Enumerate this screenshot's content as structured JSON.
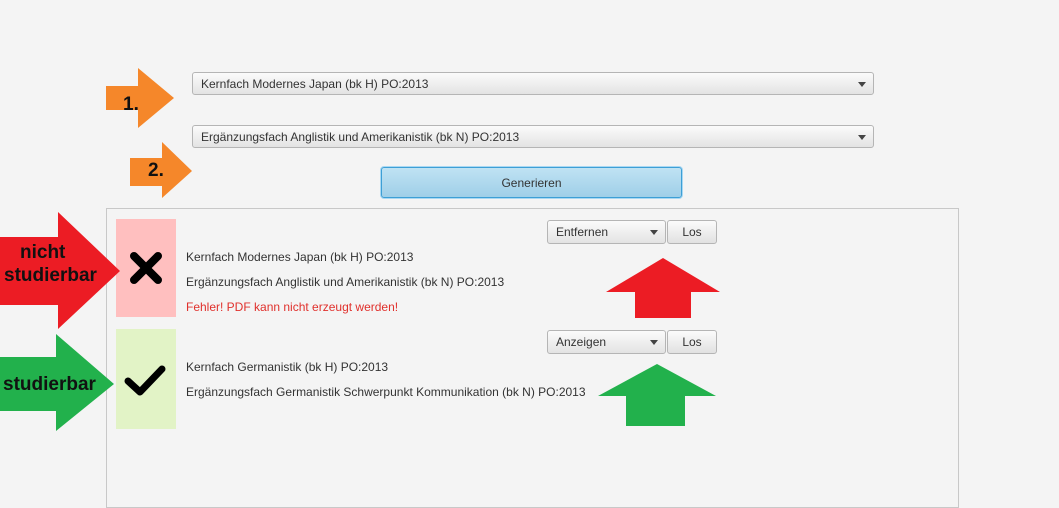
{
  "selectors": {
    "first": "Kernfach Modernes Japan (bk H) PO:2013",
    "second": "Ergänzungsfach Anglistik und Amerikanistik (bk N) PO:2013"
  },
  "generate_label": "Generieren",
  "annotations": {
    "step1": "1.",
    "step2": "2.",
    "not_studyable_line1": "nicht",
    "not_studyable_line2": "studierbar",
    "studyable": "studierbar"
  },
  "results": [
    {
      "status": "invalid",
      "status_icon": "cross-icon",
      "status_color": "#ffbfbf",
      "line1": "Kernfach Modernes Japan (bk H) PO:2013",
      "line2": "Ergänzungsfach Anglistik und Amerikanistik (bk N) PO:2013",
      "error": "Fehler! PDF kann nicht erzeugt werden!",
      "action_selected": "Entfernen",
      "go_label": "Los"
    },
    {
      "status": "valid",
      "status_icon": "check-icon",
      "status_color": "#e2f3c6",
      "line1": "Kernfach Germanistik (bk H) PO:2013",
      "line2": "Ergänzungsfach Germanistik Schwerpunkt Kommunikation (bk N) PO:2013",
      "action_selected": "Anzeigen",
      "go_label": "Los"
    }
  ],
  "colors": {
    "arrow_orange": "#f5872a",
    "arrow_red": "#ec1c24",
    "arrow_green": "#22b14c"
  }
}
